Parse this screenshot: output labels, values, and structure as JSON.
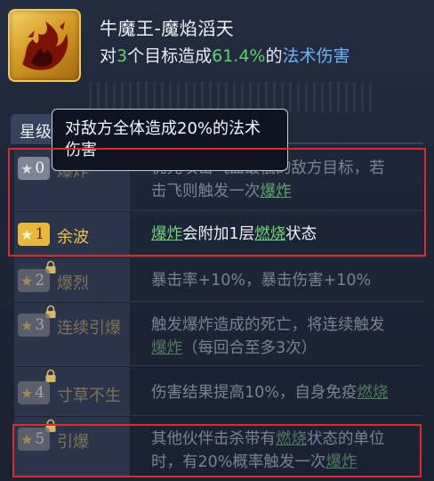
{
  "skill": {
    "title": "牛魔王-魔焰滔天",
    "desc_prefix": "对",
    "targets": "3",
    "desc_mid": "个目标造成",
    "percent": "61.4%",
    "desc_of": "的",
    "damage_type": "法术伤害",
    "icon": "flame-demon-icon"
  },
  "section": {
    "tab_label": "星级效"
  },
  "tooltip": {
    "text": "对敌方全体造成20%的法术伤害"
  },
  "rows": [
    {
      "level": "0",
      "name": "爆炸",
      "state": "active",
      "line1": "优先攻击气血最低的敌方目标，若",
      "line2_pre": "击飞则触发一次",
      "line2_link": "爆炸",
      "line2_post": ""
    },
    {
      "level": "1",
      "name": "余波",
      "state": "unlocked",
      "link1": "爆炸",
      "mid": "会附加1层",
      "link2": "燃烧",
      "post": "状态"
    },
    {
      "level": "2",
      "name": "爆烈",
      "state": "locked",
      "line1": "暴击率+10%，暴击伤害+10%"
    },
    {
      "level": "3",
      "name": "连续引爆",
      "state": "locked",
      "line1": "触发爆炸造成的死亡，将连续触发",
      "line2_link": "爆炸",
      "line2_post": "（每回合至多3次）"
    },
    {
      "level": "4",
      "name": "寸草不生",
      "state": "locked",
      "line1_pre": "伤害结果提高10%，自身免疫",
      "line1_link": "燃烧"
    },
    {
      "level": "5",
      "name": "引爆",
      "state": "locked",
      "line1_pre": "其他伙伴击杀带有",
      "line1_link": "燃烧",
      "line1_post": "状态的单位",
      "line2_pre": "时，有20%概率触发一次",
      "line2_link": "爆炸"
    }
  ],
  "colors": {
    "highlight_green": "#5fd36b",
    "highlight_blue": "#69b6f0",
    "star_gold": "#e9b83a",
    "annotation_red": "#e02a2a"
  }
}
